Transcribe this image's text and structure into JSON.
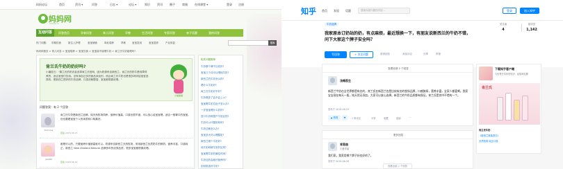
{
  "left": {
    "top_links": [
      "妈妈论坛",
      "首页",
      "资讯 ▾",
      "问答",
      "日志 ▾",
      "论坛 ▾",
      "知识",
      "资讯",
      "圈子",
      "商城",
      "在线课堂 ▾",
      "登录",
      "注册"
    ],
    "site_name": "妈妈网",
    "site_sub": "mama.cn",
    "logo_section": "互动问答",
    "nav": [
      "问答首页",
      "孕育问答",
      "育儿问答",
      "早教",
      "生活问答",
      "专家问答",
      "亲子话题",
      "我的问答"
    ],
    "sub_nav": [
      "热门问题:",
      "孕期饮食",
      "新生儿护理",
      "宝宝辅食",
      "母乳喂养",
      "早教",
      "宝宝发烧",
      "宝宝湿疹",
      "产后恢复"
    ],
    "search_btn": "搜索",
    "breadcrumb": "妈妈网首页 > 育儿问答 > 宝宝喂养 > 宝宝饮食 > 宝宝能不能喝牛奶 > 肯兰氏牛奶能喝吗?",
    "question_title": "肯兰氏牛奶的奶好吗?",
    "question_body": "小编答曰：\"喜兰氏的奶农金选择肯兰氏官网，因为奶源来自新西兰，肯兰氏的奶牛是纯草饲养的，适合宝宝们饮用。没有添加过多的食品添加剂，而且肯兰氏牛奶也是很多妈妈给宝宝选择的，是新西兰很好的牛奶品牌，口感浓郁醇香，宝宝都很喜欢喝。\"",
    "figure_tag": "小编答疑",
    "answer_count": "问题答案：有 2 个回答",
    "answers": [
      {
        "name": "Nicholas",
        "text": "肯兰氏牛奶是新西兰品牌，纯天然牧场饲养，营养价值高，口感也很不错，可以放心给宝宝喝，适合一般胃口的宝宝。但也要看宝宝个人的体质和口味喜好。",
        "meta": "2018-08-15",
        "meta_label": "回答"
      },
      {
        "name": "jzk688",
        "text": "都是可以的，只要营养价值够高就可以。奶源来自新西兰天然牧场，采用新西兰优质奶牛的鲜奶，营养丰富，口感纯正，新西兰 New Zealand Natural 品牌多年的优秀品质，很多宝宝都很喜欢喝。",
        "meta": "2018-08-16",
        "meta_label": "回答"
      }
    ],
    "sidebar_head": "相关问题推荐",
    "sidebar_items": [
      "牛奶哪个牌子比较好?",
      "宝宝几个月可以喝纯牛奶?",
      "新西兰的牛奶怎么样?",
      "喝什么牛奶好?",
      "肯兰氏牛奶好不好?",
      "牛奶喝多了会不会上火?",
      "宝宝喝牛奶拉肚子怎么办?",
      "一岁宝宝喝什么奶好?",
      "进口牛奶和国产牛奶区别?",
      "牛奶可以代替奶粉吗?",
      "牛奶过敏怎么办?",
      "宝宝多大可以喝酸奶?",
      "新西兰哪个牛奶好?",
      "纯牛奶和鲜牛奶的区别?",
      "宝宝喝牛奶的最佳时间?",
      "牛奶加热会破坏营养吗?",
      "如何挑选好牛奶?"
    ]
  },
  "right": {
    "logo": "知乎",
    "nav": [
      "首页",
      "发现",
      "话题"
    ],
    "search_placeholder": "搜索你感兴趣的内容...",
    "login": "登录",
    "join": "加入知乎",
    "topic_tag": "牛奶品牌",
    "question_title": "我家原本订奶站的奶，有点麻烦，最近想换一下，有朋友说新西兰的牛奶不错，问下大家这个牌子安全吗？",
    "stats": [
      {
        "label": "关注者",
        "value": "4"
      },
      {
        "label": "被浏览",
        "value": "1,142"
      }
    ],
    "write_btn": "写回答",
    "follow_btn": "+ 关注问题",
    "actions": [
      "邀请回答",
      "添加评论",
      "分享",
      "举报"
    ],
    "answers_head": "查看全部 2 个回答",
    "answer1": {
      "name": "浅唱吾生",
      "text": "新西兰牛奶在全世界都是有名的，肯兰氏在新西兰也是比较有名的牧场品牌，口感醇厚，营养丰富，全家人都爱喝。我家宝宝现在每天一瓶，纯天然无添加，大家可以放心选择。新西兰的牛奶品质都有保证，肯兰氏是其中不错的一个。",
      "date": "发布于 2018-06-29",
      "vote": "▲ 赞同",
      "actions": [
        "1 条评论",
        "分享",
        "收藏",
        "感谢",
        "···"
      ]
    },
    "answer2_head": "更多回答",
    "answer2": {
      "name": "肯恩曲",
      "bio": "小爱学者",
      "text": "我们家，我家用哪个牌子好也好的了。",
      "date": "发布于 2018-06-28"
    },
    "more_btn": "查看全部 2 个回答",
    "ad": {
      "name": "下载知乎客户端",
      "sub": "与世界分享你的知识、经验和见解",
      "brand_logo": "肯兰氏",
      "lines": [
        "肯兰氏牛奶",
        "《新西兰原装进口》",
        "天然牧场 纯正口感"
      ]
    }
  }
}
